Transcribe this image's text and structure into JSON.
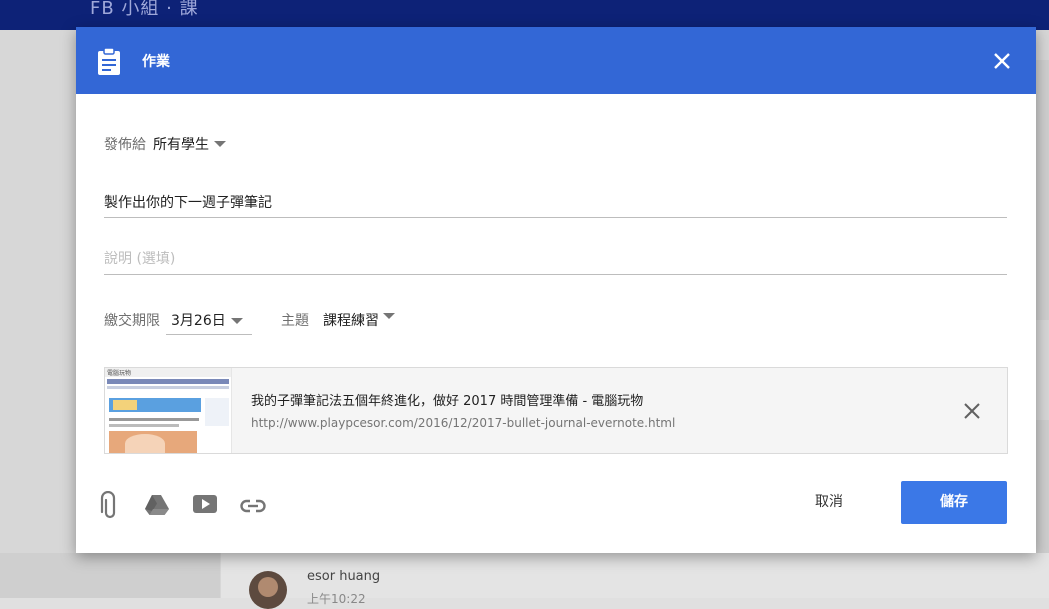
{
  "background": {
    "topbar_title": "FB 小組 · 課",
    "post_author": "esor huang",
    "post_time": "上午10:22"
  },
  "dialog": {
    "title": "作業",
    "header_color": "#3367d6",
    "assign_to": {
      "label": "發佈給",
      "value": "所有學生"
    },
    "assignment_title": "製作出你的下一週子彈筆記",
    "description_placeholder": "說明 (選填)",
    "due": {
      "label": "繳交期限",
      "value": "3月26日"
    },
    "topic": {
      "label": "主題",
      "value": "課程練習"
    },
    "attachment": {
      "thumb_brand": "電腦玩物",
      "title": "我的子彈筆記法五個年終進化，做好 2017 時間管理準備 - 電腦玩物",
      "url": "http://www.playpcesor.com/2016/12/2017-bullet-journal-evernote.html"
    },
    "toolbar_icons": [
      "paperclip-icon",
      "google-drive-icon",
      "youtube-icon",
      "link-icon"
    ],
    "cancel_label": "取消",
    "save_label": "儲存",
    "save_color": "#3b78e7"
  }
}
